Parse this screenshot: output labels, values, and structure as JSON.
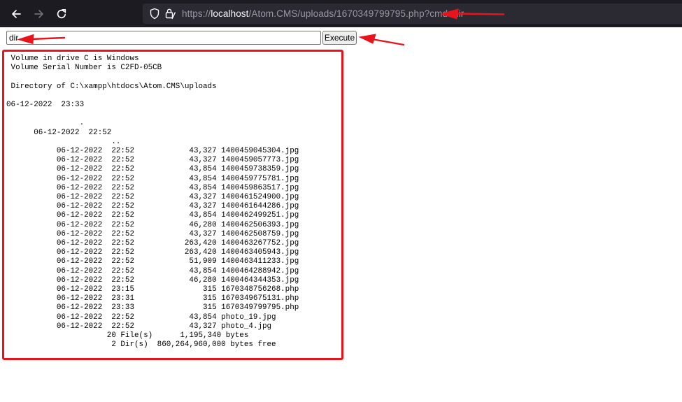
{
  "browser": {
    "url": {
      "scheme": "https://",
      "host": "localhost",
      "path": "/Atom.CMS/uploads/1670349799795.php?cmd=dir"
    },
    "icons": {
      "back": "arrow-left-icon",
      "forward": "arrow-right-icon",
      "reload": "reload-icon",
      "tracking_protection": "shield-icon",
      "security": "lock-icon"
    }
  },
  "form": {
    "command_value": "dir",
    "execute_label": "Execute"
  },
  "output": {
    "header": [
      " Volume in drive C is Windows",
      " Volume Serial Number is C2FD-05CB",
      "",
      " Directory of C:\\xampp\\htdocs\\Atom.CMS\\uploads",
      "",
      "06-12-2022  23:33",
      "",
      "                .",
      "      06-12-2022  22:52",
      "                       .."
    ],
    "files": [
      {
        "date": "06-12-2022",
        "time": "22:52",
        "size": "43,327",
        "name": "1400459045304.jpg"
      },
      {
        "date": "06-12-2022",
        "time": "22:52",
        "size": "43,327",
        "name": "1400459057773.jpg"
      },
      {
        "date": "06-12-2022",
        "time": "22:52",
        "size": "43,854",
        "name": "1400459738359.jpg"
      },
      {
        "date": "06-12-2022",
        "time": "22:52",
        "size": "43,854",
        "name": "1400459775781.jpg"
      },
      {
        "date": "06-12-2022",
        "time": "22:52",
        "size": "43,854",
        "name": "1400459863517.jpg"
      },
      {
        "date": "06-12-2022",
        "time": "22:52",
        "size": "43,327",
        "name": "1400461524900.jpg"
      },
      {
        "date": "06-12-2022",
        "time": "22:52",
        "size": "43,327",
        "name": "1400461644286.jpg"
      },
      {
        "date": "06-12-2022",
        "time": "22:52",
        "size": "43,854",
        "name": "1400462499251.jpg"
      },
      {
        "date": "06-12-2022",
        "time": "22:52",
        "size": "46,280",
        "name": "1400462506393.jpg"
      },
      {
        "date": "06-12-2022",
        "time": "22:52",
        "size": "43,327",
        "name": "1400462508759.jpg"
      },
      {
        "date": "06-12-2022",
        "time": "22:52",
        "size": "263,420",
        "name": "1400463267752.jpg"
      },
      {
        "date": "06-12-2022",
        "time": "22:52",
        "size": "263,420",
        "name": "1400463405943.jpg"
      },
      {
        "date": "06-12-2022",
        "time": "22:52",
        "size": "51,909",
        "name": "1400463411233.jpg"
      },
      {
        "date": "06-12-2022",
        "time": "22:52",
        "size": "43,854",
        "name": "1400464288942.jpg"
      },
      {
        "date": "06-12-2022",
        "time": "22:52",
        "size": "46,280",
        "name": "1400464344353.jpg"
      },
      {
        "date": "06-12-2022",
        "time": "23:15",
        "size": "315",
        "name": "1670348756268.php"
      },
      {
        "date": "06-12-2022",
        "time": "23:31",
        "size": "315",
        "name": "1670349675131.php"
      },
      {
        "date": "06-12-2022",
        "time": "23:33",
        "size": "315",
        "name": "1670349799795.php"
      },
      {
        "date": "06-12-2022",
        "time": "22:52",
        "size": "43,854",
        "name": "photo_19.jpg"
      },
      {
        "date": "06-12-2022",
        "time": "22:52",
        "size": "43,327",
        "name": "photo_4.jpg"
      }
    ],
    "summary": [
      "                      20 File(s)      1,195,340 bytes",
      "                       2 Dir(s)  860,264,960,000 bytes free"
    ]
  },
  "annotations": {
    "color": "#e8141c"
  }
}
